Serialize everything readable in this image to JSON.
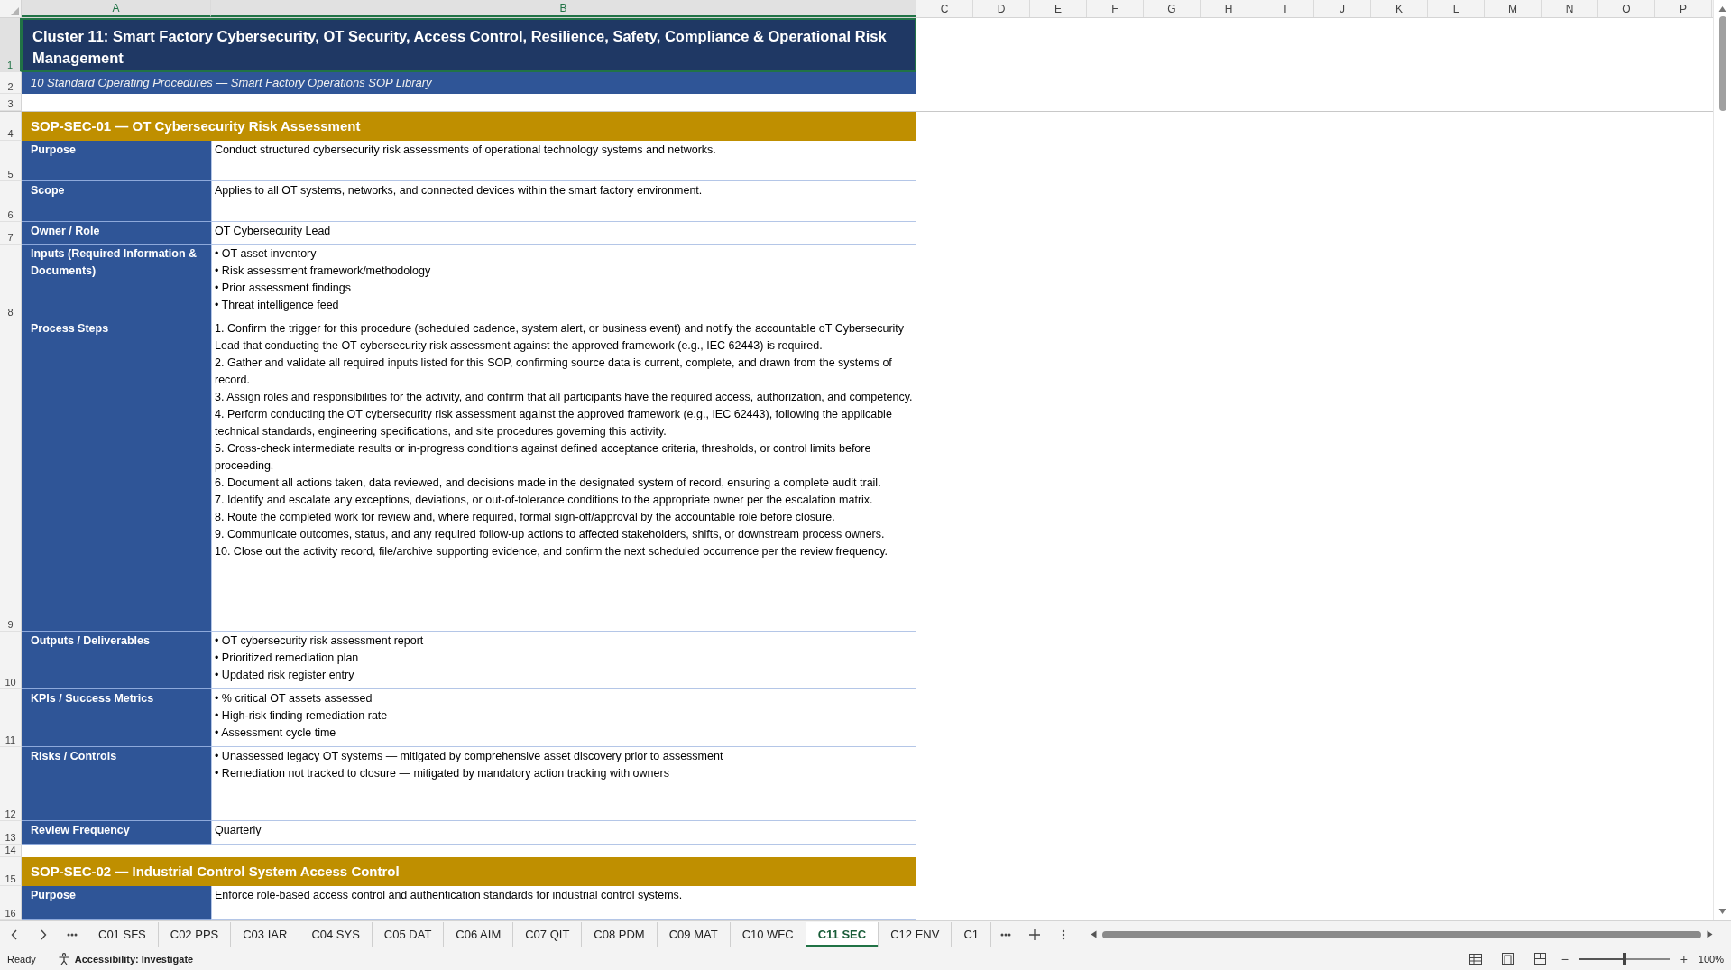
{
  "columns": [
    {
      "label": "A",
      "selected": true
    },
    {
      "label": "B",
      "selected": true
    },
    {
      "label": "C",
      "selected": false
    },
    {
      "label": "D",
      "selected": false
    },
    {
      "label": "E",
      "selected": false
    },
    {
      "label": "F",
      "selected": false
    },
    {
      "label": "G",
      "selected": false
    },
    {
      "label": "H",
      "selected": false
    },
    {
      "label": "I",
      "selected": false
    },
    {
      "label": "J",
      "selected": false
    },
    {
      "label": "K",
      "selected": false
    },
    {
      "label": "L",
      "selected": false
    },
    {
      "label": "M",
      "selected": false
    },
    {
      "label": "N",
      "selected": false
    },
    {
      "label": "O",
      "selected": false
    },
    {
      "label": "P",
      "selected": false
    }
  ],
  "rows": [
    {
      "row_number": "1",
      "selected": true,
      "kind": "title",
      "text": "Cluster 11: Smart Factory Cybersecurity, OT Security, Access Control, Resilience, Safety, Compliance & Operational Risk Management"
    },
    {
      "row_number": "2",
      "selected": false,
      "kind": "subtitle",
      "text": "10 Standard Operating Procedures — Smart Factory Operations SOP Library"
    },
    {
      "row_number": "3",
      "selected": false,
      "kind": "blank"
    },
    {
      "row_number": "4",
      "selected": false,
      "kind": "section",
      "text": "SOP-SEC-01  —  OT Cybersecurity Risk Assessment"
    },
    {
      "row_number": "5",
      "selected": false,
      "kind": "field",
      "label": "Purpose",
      "lines": [
        "Conduct structured cybersecurity risk assessments of operational technology systems and networks."
      ]
    },
    {
      "row_number": "6",
      "selected": false,
      "kind": "field",
      "label": "Scope",
      "lines": [
        "Applies to all OT systems, networks, and connected devices within the smart factory environment."
      ]
    },
    {
      "row_number": "7",
      "selected": false,
      "kind": "field",
      "label": "Owner / Role",
      "lines": [
        "OT Cybersecurity Lead"
      ]
    },
    {
      "row_number": "8",
      "selected": false,
      "kind": "field",
      "label": "Inputs (Required Information & Documents)",
      "lines": [
        "• OT asset inventory",
        "• Risk assessment framework/methodology",
        "• Prior assessment findings",
        "• Threat intelligence feed"
      ]
    },
    {
      "row_number": "9",
      "selected": false,
      "kind": "field",
      "label": "Process Steps",
      "lines": [
        "1. Confirm the trigger for this procedure (scheduled cadence, system alert, or business event) and notify the accountable oT Cybersecurity Lead that conducting the OT cybersecurity risk assessment against the approved framework (e.g., IEC 62443) is required.",
        "2. Gather and validate all required inputs listed for this SOP, confirming source data is current, complete, and drawn from the systems of record.",
        "3. Assign roles and responsibilities for the activity, and confirm that all participants have the required access, authorization, and competency.",
        "4. Perform conducting the OT cybersecurity risk assessment against the approved framework (e.g., IEC 62443), following the applicable technical standards, engineering specifications, and site procedures governing this activity.",
        "5. Cross-check intermediate results or in-progress conditions against defined acceptance criteria, thresholds, or control limits before proceeding.",
        "6. Document all actions taken, data reviewed, and decisions made in the designated system of record, ensuring a complete audit trail.",
        "7. Identify and escalate any exceptions, deviations, or out-of-tolerance conditions to the appropriate owner per the escalation matrix.",
        "8. Route the completed work for review and, where required, formal sign-off/approval by the accountable role before closure.",
        "9. Communicate outcomes, status, and any required follow-up actions to affected stakeholders, shifts, or downstream process owners.",
        "10. Close out the activity record, file/archive supporting evidence, and confirm the next scheduled occurrence per the review frequency."
      ]
    },
    {
      "row_number": "10",
      "selected": false,
      "kind": "field",
      "label": "Outputs / Deliverables",
      "lines": [
        "• OT cybersecurity risk assessment report",
        "• Prioritized remediation plan",
        "• Updated risk register entry"
      ]
    },
    {
      "row_number": "11",
      "selected": false,
      "kind": "field",
      "label": "KPIs / Success Metrics",
      "lines": [
        "• % critical OT assets assessed",
        "• High-risk finding remediation rate",
        "• Assessment cycle time"
      ]
    },
    {
      "row_number": "12",
      "selected": false,
      "kind": "field",
      "label": "Risks / Controls",
      "lines": [
        "• Unassessed legacy OT systems — mitigated by comprehensive asset discovery prior to assessment",
        "• Remediation not tracked to closure — mitigated by mandatory action tracking with owners"
      ]
    },
    {
      "row_number": "13",
      "selected": false,
      "kind": "field",
      "label": "Review Frequency",
      "lines": [
        "Quarterly"
      ]
    },
    {
      "row_number": "14",
      "selected": false,
      "kind": "blank"
    },
    {
      "row_number": "15",
      "selected": false,
      "kind": "section",
      "text": "SOP-SEC-02  —  Industrial Control System Access Control"
    },
    {
      "row_number": "16",
      "selected": false,
      "kind": "field",
      "label": "Purpose",
      "lines": [
        "Enforce role-based access control and authentication standards for industrial control systems."
      ]
    }
  ],
  "sheet_tabs": [
    {
      "label": "C01 SFS",
      "selected": false
    },
    {
      "label": "C02 PPS",
      "selected": false
    },
    {
      "label": "C03 IAR",
      "selected": false
    },
    {
      "label": "C04 SYS",
      "selected": false
    },
    {
      "label": "C05 DAT",
      "selected": false
    },
    {
      "label": "C06 AIM",
      "selected": false
    },
    {
      "label": "C07 QIT",
      "selected": false
    },
    {
      "label": "C08 PDM",
      "selected": false
    },
    {
      "label": "C09 MAT",
      "selected": false
    },
    {
      "label": "C10 WFC",
      "selected": false
    },
    {
      "label": "C11 SEC",
      "selected": true
    },
    {
      "label": "C12 ENV",
      "selected": false
    },
    {
      "label": "C1",
      "selected": false
    }
  ],
  "status_bar": {
    "mode": "Ready",
    "accessibility": "Accessibility: Investigate",
    "zoom_out": "−",
    "zoom_in": "+",
    "zoom": {
      "level": 0.5
    },
    "zoom_label": "100%"
  }
}
